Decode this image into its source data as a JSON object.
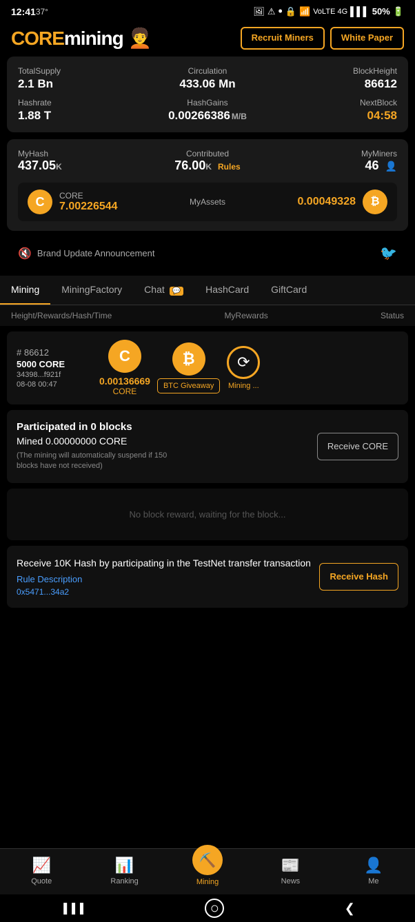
{
  "statusBar": {
    "time": "12:41",
    "degree": "37°",
    "battery": "50%"
  },
  "header": {
    "logoCore": "CORE",
    "logoMining": "mining",
    "recruitBtn": "Recruit\nMiners",
    "whitepaperBtn": "White\nPaper"
  },
  "stats": {
    "totalSupplyLabel": "TotalSupply",
    "totalSupplyValue": "2.1 Bn",
    "circulationLabel": "Circulation",
    "circulationValue": "433.06 Mn",
    "blockHeightLabel": "BlockHeight",
    "blockHeightValue": "86612",
    "hashrateLabel": "Hashrate",
    "hashrateValue": "1.88 T",
    "hashGainsLabel": "HashGains",
    "hashGainsValue": "0.00266386",
    "hashGainsUnit": "M/B",
    "nextBlockLabel": "NextBlock",
    "nextBlockValue": "04:58"
  },
  "myHash": {
    "myHashLabel": "MyHash",
    "myHashValue": "437.05",
    "myHashUnit": "K",
    "contributedLabel": "Contributed",
    "contributedValue": "76.00",
    "contributedUnit": "K",
    "rulesLink": "Rules",
    "myMinersLabel": "MyMiners",
    "myMinersValue": "46"
  },
  "assets": {
    "coreLabel": "CORE",
    "coreAmount": "7.00226544",
    "myAssetsLabel": "MyAssets",
    "btcAmount": "0.00049328",
    "btcLabel": "BTC"
  },
  "announcement": {
    "text": "Brand Update Announcement"
  },
  "tabs": [
    {
      "label": "Mining",
      "active": true
    },
    {
      "label": "MiningFactory",
      "active": false
    },
    {
      "label": "Chat",
      "active": false,
      "badge": "💬"
    },
    {
      "label": "HashCard",
      "active": false
    },
    {
      "label": "GiftCard",
      "active": false
    }
  ],
  "tableHeader": {
    "left": "Height/Rewards/Hash/Time",
    "center": "MyRewards",
    "right": "Status"
  },
  "miningRow": {
    "block": "# 86612",
    "reward": "5000 CORE",
    "hash": "34398...f921f",
    "time": "08-08 00:47",
    "coreAmount": "0.00136669",
    "coreLabel": "CORE",
    "btcGiveaway": "BTC Giveaway",
    "statusText": "Mining ..."
  },
  "participated": {
    "title": "Participated in 0 blocks",
    "amount": "Mined 0.00000000 CORE",
    "note": "(The mining will automatically suspend if 150 blocks have not received)",
    "btn": "Receive\nCORE"
  },
  "noReward": {
    "text": "No block reward, waiting for the block..."
  },
  "receiveHash": {
    "title": "Receive 10K Hash by participating in\nthe TestNet transfer transaction",
    "ruleLink": "Rule Description",
    "address": "0x5471...34a2",
    "btn": "Receive\nHash"
  },
  "bottomNav": [
    {
      "icon": "📈",
      "label": "Quote",
      "active": false
    },
    {
      "icon": "📊",
      "label": "Ranking",
      "active": false
    },
    {
      "icon": "⛏️",
      "label": "Mining",
      "active": true,
      "isMining": true
    },
    {
      "icon": "📰",
      "label": "News",
      "active": false
    },
    {
      "icon": "👤",
      "label": "Me",
      "active": false
    }
  ],
  "systemNav": {
    "back": "❮",
    "home": "○",
    "recent": "▐▐▐"
  }
}
